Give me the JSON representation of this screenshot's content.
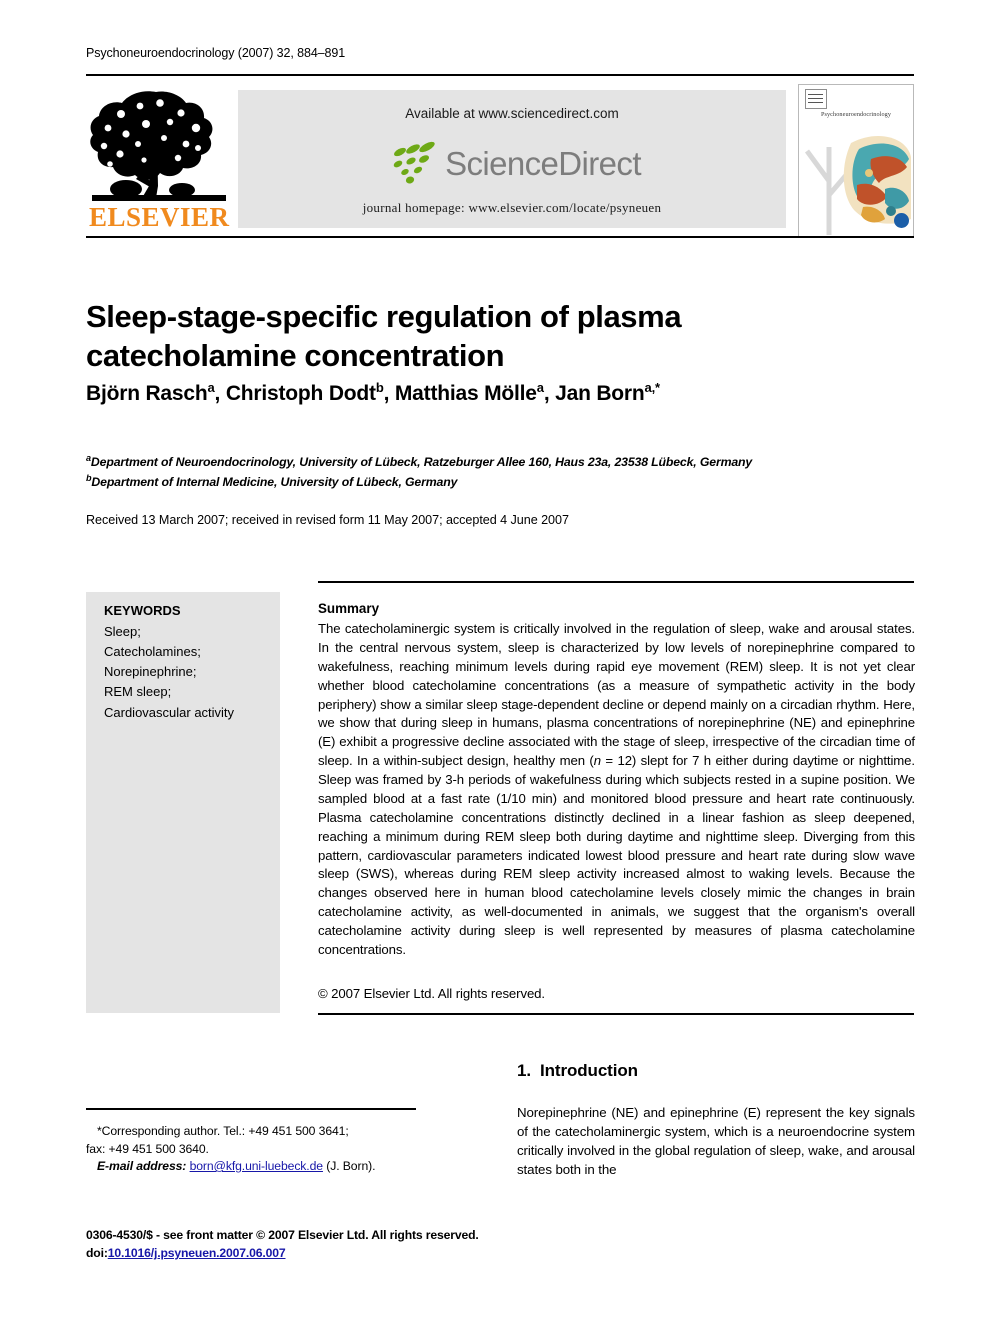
{
  "running_head": "Psychoneuroendocrinology (2007) 32, 884–891",
  "masthead": {
    "publisher_name": "ELSEVIER",
    "available_at": "Available at www.sciencedirect.com",
    "sciencedirect_wordmark": "ScienceDirect",
    "journal_homepage": "journal homepage: www.elsevier.com/locate/psyneuen",
    "cover_title": "Psychoneuroendocrinology"
  },
  "article": {
    "title": "Sleep-stage-specific regulation of plasma catecholamine concentration",
    "authors": [
      {
        "name": "Björn Rasch",
        "marks": "a"
      },
      {
        "name": "Christoph Dodt",
        "marks": "b"
      },
      {
        "name": "Matthias Mölle",
        "marks": "a"
      },
      {
        "name": "Jan Born",
        "marks": "a,*"
      }
    ],
    "affiliations": [
      {
        "mark": "a",
        "text": "Department of Neuroendocrinology, University of Lübeck, Ratzeburger Allee 160, Haus 23a, 23538 Lübeck, Germany"
      },
      {
        "mark": "b",
        "text": "Department of Internal Medicine, University of Lübeck, Germany"
      }
    ],
    "history": "Received 13 March 2007; received in revised form 11 May 2007; accepted 4 June 2007"
  },
  "keywords": {
    "heading": "KEYWORDS",
    "items": "Sleep;\nCatecholamines;\nNorepinephrine;\nREM sleep;\nCardiovascular activity"
  },
  "summary": {
    "heading": "Summary",
    "text": "The catecholaminergic system is critically involved in the regulation of sleep, wake and arousal states. In the central nervous system, sleep is characterized by low levels of norepinephrine compared to wakefulness, reaching minimum levels during rapid eye movement (REM) sleep. It is not yet clear whether blood catecholamine concentrations (as a measure of sympathetic activity in the body periphery) show a similar sleep stage-dependent decline or depend mainly on a circadian rhythm. Here, we show that during sleep in humans, plasma concentrations of norepinephrine (NE) and epinephrine (E) exhibit a progressive decline associated with the stage of sleep, irrespective of the circadian time of sleep. In a within-subject design, healthy men (n = 12) slept for 7 h either during daytime or nighttime. Sleep was framed by 3-h periods of wakefulness during which subjects rested in a supine position. We sampled blood at a fast rate (1/10 min) and monitored blood pressure and heart rate continuously. Plasma catecholamine concentrations distinctly declined in a linear fashion as sleep deepened, reaching a minimum during REM sleep both during daytime and nighttime sleep. Diverging from this pattern, cardiovascular parameters indicated lowest blood pressure and heart rate during slow wave sleep (SWS), whereas during REM sleep activity increased almost to waking levels. Because the changes observed here in human blood catecholamine levels closely mimic the changes in brain catecholamine activity, as well-documented in animals, we suggest that the organism's overall catecholamine activity during sleep is well represented by measures of plasma catecholamine concentrations.",
    "copyright": "© 2007 Elsevier Ltd. All rights reserved."
  },
  "introduction": {
    "number": "1.",
    "heading": "Introduction",
    "text": "Norepinephrine (NE) and epinephrine (E) represent the key signals of the catecholaminergic system, which is a neuroendocrine system critically involved in the global regulation of sleep, wake, and arousal states both in the"
  },
  "footnote": {
    "corresponding_line1": "*Corresponding author. Tel.: +49 451 500 3641;",
    "corresponding_line2": "fax: +49 451 500 3640.",
    "email_label": "E-mail address:",
    "email_address": "born@kfg.uni-luebeck.de",
    "email_owner": "(J. Born)."
  },
  "footer": {
    "issn_line": "0306-4530/$ - see front matter © 2007 Elsevier Ltd. All rights reserved.",
    "doi_prefix": "doi:",
    "doi_value": "10.1016/j.psyneuen.2007.06.007"
  },
  "colors": {
    "elsevier_orange": "#F08A1E",
    "sciencedirect_green": "#6EA916",
    "sciencedirect_gray": "#7d7d7d",
    "banner_background": "#e4e4e4",
    "link_blue": "#1717a8"
  }
}
